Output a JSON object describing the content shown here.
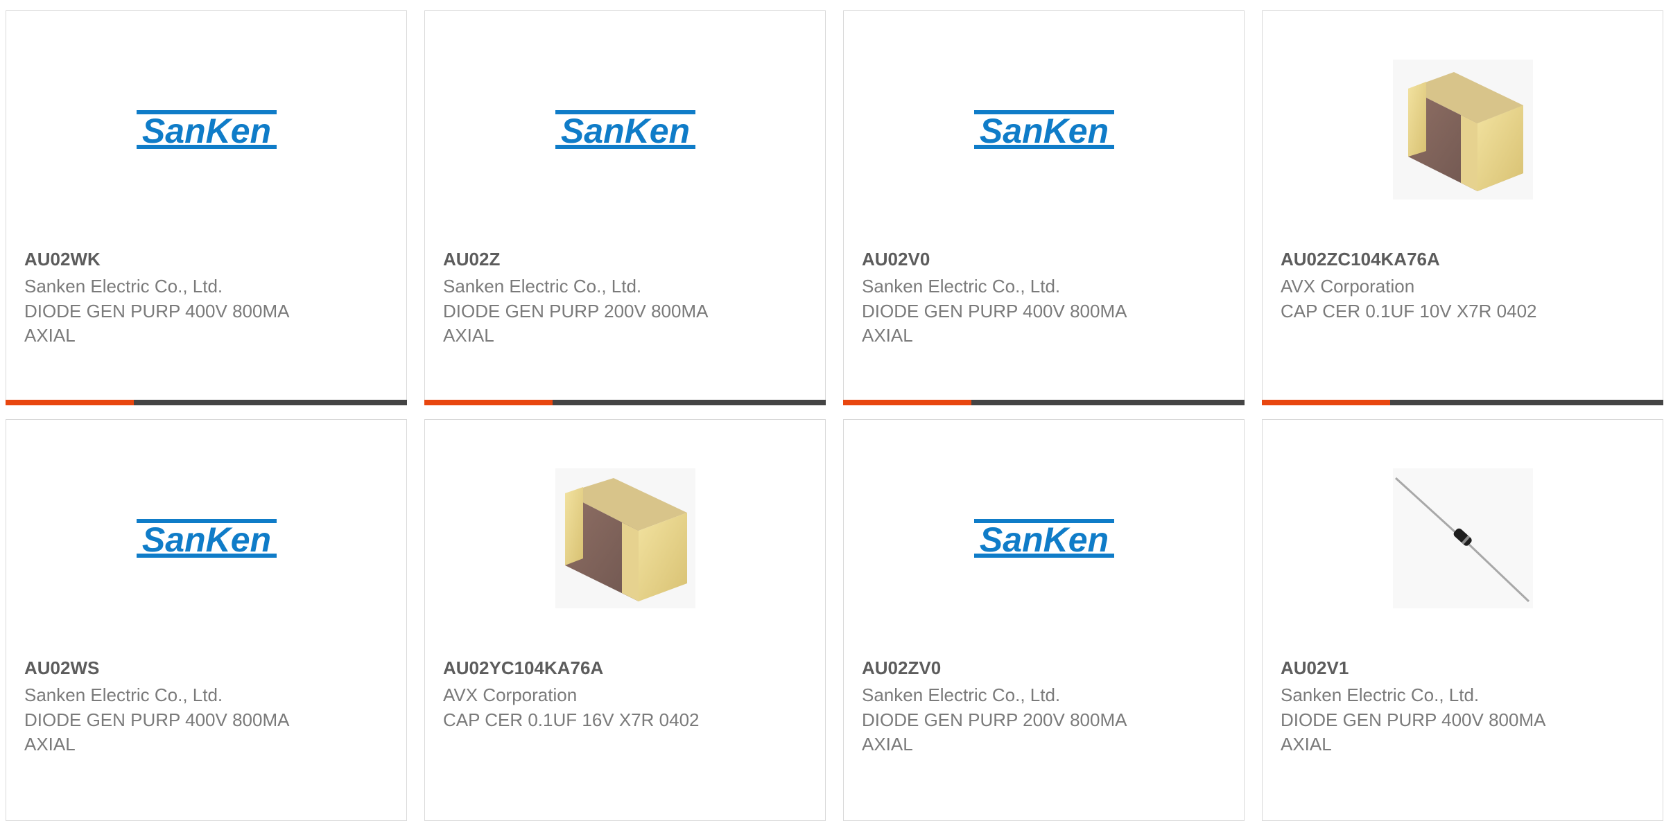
{
  "colors": {
    "accent": "#e8460f",
    "bar_track": "#444444",
    "part_number_text": "#5c5c5c",
    "secondary_text": "#7a7a7a",
    "sanken_blue": "#0f7cc8"
  },
  "products": [
    {
      "part_number": "AU02WK",
      "manufacturer": "Sanken Electric Co., Ltd.",
      "description_line1": "DIODE GEN PURP 400V 800MA",
      "description_line2": "AXIAL",
      "image": "sanken-logo",
      "progress": 0.32
    },
    {
      "part_number": "AU02Z",
      "manufacturer": "Sanken Electric Co., Ltd.",
      "description_line1": "DIODE GEN PURP 200V 800MA",
      "description_line2": "AXIAL",
      "image": "sanken-logo",
      "progress": 0.32
    },
    {
      "part_number": "AU02V0",
      "manufacturer": "Sanken Electric Co., Ltd.",
      "description_line1": "DIODE GEN PURP 400V 800MA",
      "description_line2": "AXIAL",
      "image": "sanken-logo",
      "progress": 0.32
    },
    {
      "part_number": "AU02ZC104KA76A",
      "manufacturer": "AVX Corporation",
      "description_line1": "CAP CER 0.1UF 10V X7R 0402",
      "description_line2": "",
      "image": "ceramic-capacitor-photo",
      "progress": 0.32
    },
    {
      "part_number": "AU02WS",
      "manufacturer": "Sanken Electric Co., Ltd.",
      "description_line1": "DIODE GEN PURP 400V 800MA",
      "description_line2": "AXIAL",
      "image": "sanken-logo"
    },
    {
      "part_number": "AU02YC104KA76A",
      "manufacturer": "AVX Corporation",
      "description_line1": "CAP CER 0.1UF 16V X7R 0402",
      "description_line2": "",
      "image": "ceramic-capacitor-photo"
    },
    {
      "part_number": "AU02ZV0",
      "manufacturer": "Sanken Electric Co., Ltd.",
      "description_line1": "DIODE GEN PURP 200V 800MA",
      "description_line2": "AXIAL",
      "image": "sanken-logo"
    },
    {
      "part_number": "AU02V1",
      "manufacturer": "Sanken Electric Co., Ltd.",
      "description_line1": "DIODE GEN PURP 400V 800MA",
      "description_line2": "AXIAL",
      "image": "axial-diode-photo"
    }
  ],
  "sanken_logo_text": "SanKen"
}
